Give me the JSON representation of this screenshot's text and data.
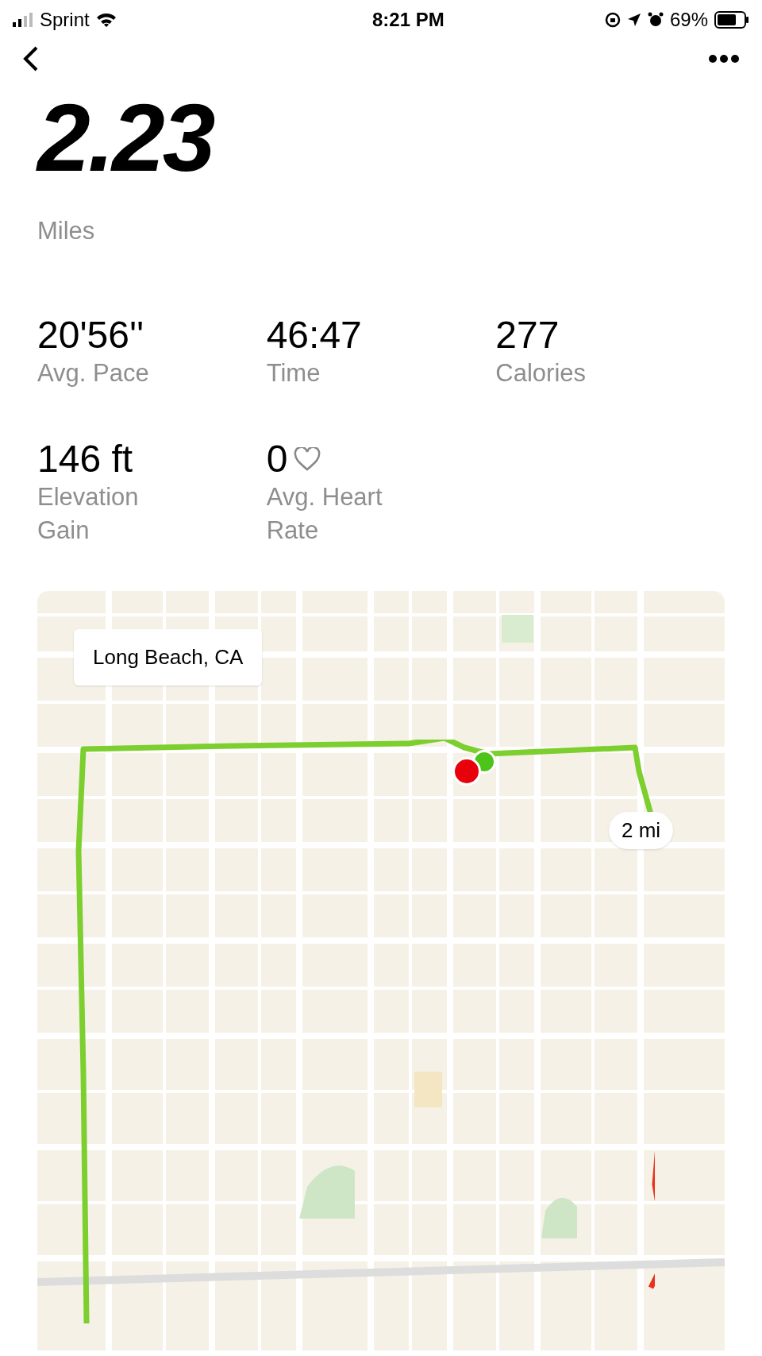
{
  "status_bar": {
    "carrier": "Sprint",
    "time": "8:21 PM",
    "battery": "69%"
  },
  "distance": {
    "value": "2.23",
    "unit": "Miles"
  },
  "stats": [
    {
      "value": "20'56''",
      "label": "Avg. Pace",
      "kind": "plain"
    },
    {
      "value": "46:47",
      "label": "Time",
      "kind": "plain"
    },
    {
      "value": "277",
      "label": "Calories",
      "kind": "plain"
    },
    {
      "value": "146 ft",
      "label": "Elevation Gain",
      "kind": "plain"
    },
    {
      "value": "0",
      "label": "Avg. Heart Rate",
      "kind": "heart"
    }
  ],
  "map": {
    "location": "Long Beach, CA",
    "markers": [
      "2 mi"
    ]
  }
}
